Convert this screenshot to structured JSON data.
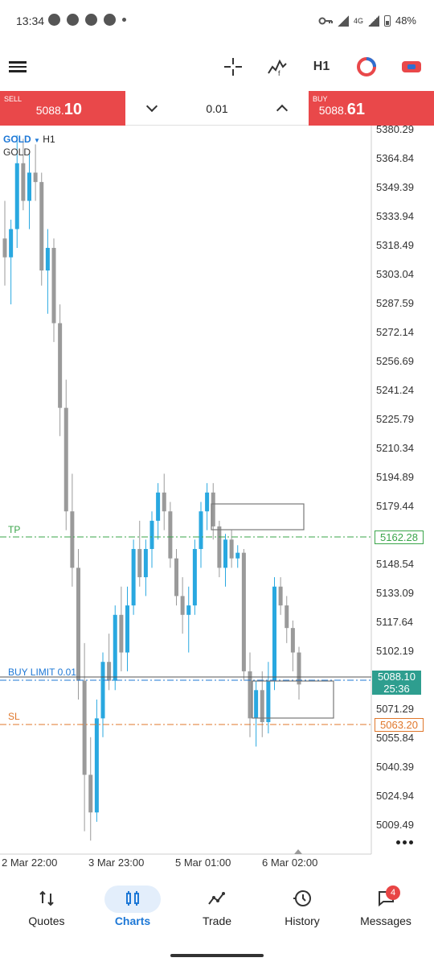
{
  "status_bar": {
    "time": "13:34",
    "network": "4G",
    "battery": "48%",
    "app_icons": [
      "whatsapp-icon",
      "chat-icon",
      "telegram-icon",
      "pinterest-icon"
    ]
  },
  "toolbar": {
    "timeframe": "H1",
    "icons": [
      "menu-icon",
      "crosshair-icon",
      "indicators-icon",
      "timeframe",
      "objects-icon",
      "trade-icon"
    ]
  },
  "trade_panel": {
    "sell": {
      "label": "SELL",
      "price_main": "5088.",
      "price_big": "10"
    },
    "buy": {
      "label": "BUY",
      "price_main": "5088.",
      "price_big": "61"
    },
    "volume": "0.01"
  },
  "chart": {
    "symbol": "GOLD",
    "timeframe": "H1",
    "description": "GOLD",
    "colors": {
      "bull": "#29a8e0",
      "bear": "#9a9a9a",
      "tp": "#3aa54a",
      "sl": "#e0772b",
      "limit": "#1e78d6",
      "bid": "#2e9e8f"
    },
    "price_axis": [
      "5380.29",
      "5364.84",
      "5349.39",
      "5333.94",
      "5318.49",
      "5303.04",
      "5287.59",
      "5272.14",
      "5256.69",
      "5241.24",
      "5225.79",
      "5210.34",
      "5194.89",
      "5179.44",
      "5148.54",
      "5133.09",
      "5117.64",
      "5102.19",
      "5071.29",
      "5055.84",
      "5040.39",
      "5024.94",
      "5009.49"
    ],
    "time_axis": [
      "2 Mar 22:00",
      "3 Mar 23:00",
      "5 Mar 01:00",
      "6 Mar 02:00"
    ],
    "levels": {
      "tp": {
        "label": "TP",
        "price": "5162.28"
      },
      "sl": {
        "label": "SL",
        "price": "5063.20"
      },
      "buy_limit": {
        "label": "BUY LIMIT 0.01"
      },
      "bid": {
        "price": "5088.10",
        "countdown": "25:36"
      }
    }
  },
  "chart_data": {
    "type": "candlestick",
    "title": "GOLD, H1",
    "ylim": [
      5000,
      5385
    ],
    "candles": [
      [
        5325,
        5345,
        5300,
        5315
      ],
      [
        5315,
        5335,
        5290,
        5330
      ],
      [
        5330,
        5380,
        5320,
        5365
      ],
      [
        5365,
        5378,
        5340,
        5345
      ],
      [
        5345,
        5370,
        5330,
        5360
      ],
      [
        5360,
        5375,
        5345,
        5355
      ],
      [
        5355,
        5360,
        5300,
        5308
      ],
      [
        5308,
        5330,
        5285,
        5320
      ],
      [
        5320,
        5325,
        5270,
        5280
      ],
      [
        5280,
        5290,
        5220,
        5235
      ],
      [
        5235,
        5250,
        5170,
        5180
      ],
      [
        5180,
        5200,
        5140,
        5150
      ],
      [
        5150,
        5160,
        5080,
        5090
      ],
      [
        5090,
        5110,
        5010,
        5040
      ],
      [
        5040,
        5060,
        5005,
        5020
      ],
      [
        5020,
        5080,
        5015,
        5070
      ],
      [
        5070,
        5105,
        5060,
        5100
      ],
      [
        5100,
        5115,
        5085,
        5090
      ],
      [
        5090,
        5130,
        5085,
        5125
      ],
      [
        5125,
        5140,
        5095,
        5105
      ],
      [
        5105,
        5140,
        5095,
        5130
      ],
      [
        5130,
        5165,
        5125,
        5160
      ],
      [
        5160,
        5175,
        5140,
        5145
      ],
      [
        5145,
        5165,
        5135,
        5160
      ],
      [
        5160,
        5180,
        5150,
        5175
      ],
      [
        5175,
        5195,
        5165,
        5190
      ],
      [
        5190,
        5200,
        5170,
        5180
      ],
      [
        5180,
        5185,
        5150,
        5155
      ],
      [
        5155,
        5160,
        5130,
        5135
      ],
      [
        5135,
        5145,
        5115,
        5125
      ],
      [
        5125,
        5140,
        5105,
        5130
      ],
      [
        5130,
        5165,
        5125,
        5160
      ],
      [
        5160,
        5185,
        5150,
        5180
      ],
      [
        5180,
        5195,
        5170,
        5190
      ],
      [
        5190,
        5195,
        5165,
        5172
      ],
      [
        5172,
        5175,
        5145,
        5150
      ],
      [
        5150,
        5168,
        5140,
        5165
      ],
      [
        5165,
        5170,
        5150,
        5155
      ],
      [
        5155,
        5162,
        5150,
        5158
      ],
      [
        5158,
        5160,
        5090,
        5095
      ],
      [
        5095,
        5105,
        5060,
        5070
      ],
      [
        5070,
        5090,
        5055,
        5085
      ],
      [
        5085,
        5095,
        5060,
        5068
      ],
      [
        5068,
        5100,
        5062,
        5090
      ],
      [
        5090,
        5145,
        5085,
        5140
      ],
      [
        5140,
        5145,
        5125,
        5130
      ],
      [
        5130,
        5135,
        5110,
        5118
      ],
      [
        5118,
        5122,
        5095,
        5105
      ],
      [
        5105,
        5108,
        5080,
        5088
      ]
    ]
  },
  "bottom_nav": [
    {
      "label": "Quotes",
      "icon": "quotes-icon"
    },
    {
      "label": "Charts",
      "icon": "charts-icon",
      "active": true
    },
    {
      "label": "Trade",
      "icon": "trade-icon"
    },
    {
      "label": "History",
      "icon": "history-icon"
    },
    {
      "label": "Messages",
      "icon": "messages-icon",
      "badge": "4"
    }
  ]
}
